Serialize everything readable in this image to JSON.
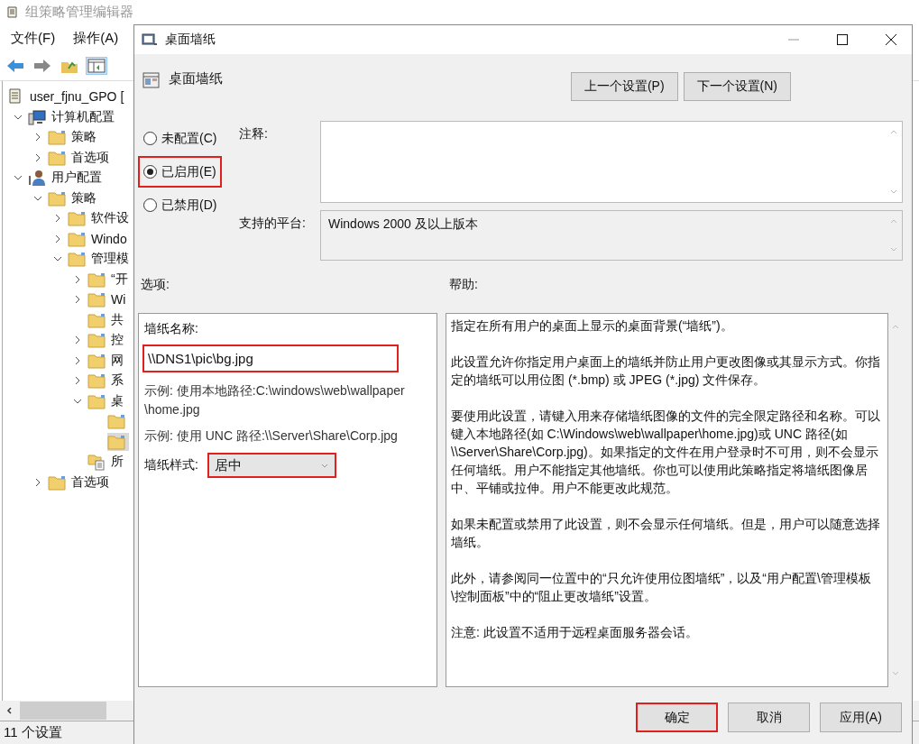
{
  "main_window": {
    "title": "组策略管理编辑器",
    "menu": [
      {
        "label": "文件(F)"
      },
      {
        "label": "操作(A)"
      }
    ],
    "tree": [
      {
        "label": "user_fjnu_GPO [",
        "kind": "root",
        "selected": false,
        "children": [
          {
            "label": "计算机配置",
            "kind": "computer",
            "expanded": true,
            "selected": false,
            "children": [
              {
                "label": "策略",
                "kind": "folder",
                "expanded": false,
                "selected": false
              },
              {
                "label": "首选项",
                "kind": "folder",
                "expanded": false,
                "selected": false
              }
            ]
          },
          {
            "label": "用户配置",
            "kind": "user",
            "expanded": true,
            "selected": false,
            "children": [
              {
                "label": "策略",
                "kind": "folder",
                "expanded": true,
                "selected": false,
                "children": [
                  {
                    "label": "软件设",
                    "kind": "folder",
                    "expanded": false,
                    "selected": false
                  },
                  {
                    "label": "Windo",
                    "kind": "folder",
                    "expanded": false,
                    "selected": false
                  },
                  {
                    "label": "管理模",
                    "kind": "folder",
                    "expanded": true,
                    "selected": false,
                    "children": [
                      {
                        "label": "“开",
                        "kind": "folder",
                        "expanded": false,
                        "selected": false
                      },
                      {
                        "label": "Wi",
                        "kind": "folder",
                        "expanded": false,
                        "selected": false
                      },
                      {
                        "label": "共",
                        "kind": "folder",
                        "selected": false
                      },
                      {
                        "label": "控",
                        "kind": "folder",
                        "expanded": false,
                        "selected": false
                      },
                      {
                        "label": "网",
                        "kind": "folder",
                        "expanded": false,
                        "selected": false
                      },
                      {
                        "label": "系",
                        "kind": "folder",
                        "expanded": false,
                        "selected": false
                      },
                      {
                        "label": "桌",
                        "kind": "folder",
                        "expanded": true,
                        "selected": false,
                        "children": [
                          {
                            "kind": "folder",
                            "selected": false
                          },
                          {
                            "kind": "folder",
                            "selected": true
                          }
                        ]
                      },
                      {
                        "label": "所",
                        "kind": "all-settings",
                        "selected": false
                      }
                    ]
                  }
                ]
              },
              {
                "label": "首选项",
                "kind": "folder",
                "expanded": false,
                "selected": false
              }
            ]
          }
        ]
      }
    ],
    "status": "11 个设置"
  },
  "dialog": {
    "title": "桌面墙纸",
    "setting_name": "桌面墙纸",
    "nav_buttons": [
      {
        "label": "上一个设置(P)"
      },
      {
        "label": "下一个设置(N)"
      }
    ],
    "radios": [
      {
        "label": "未配置(C)",
        "selected": false,
        "highlighted": false
      },
      {
        "label": "已启用(E)",
        "selected": true,
        "highlighted": true
      },
      {
        "label": "已禁用(D)",
        "selected": false,
        "highlighted": false
      }
    ],
    "comment_label": "注释:",
    "platform_label": "支持的平台:",
    "platform": "Windows 2000 及以上版本",
    "options_label": "选项:",
    "help_label": "帮助:",
    "options": {
      "name_label": "墙纸名称:",
      "name_value": "\\\\DNS1\\pic\\bg.jpg",
      "name_highlighted": true,
      "examples": [
        "示例: 使用本地路径:C:\\windows\\web\\wallpaper\\home.jpg",
        "示例: 使用 UNC 路径:\\\\Server\\Share\\Corp.jpg"
      ],
      "style_label": "墙纸样式:",
      "style_value": "居中",
      "style_highlighted": true
    },
    "help": [
      "指定在所有用户的桌面上显示的桌面背景(“墙纸”)。",
      "此设置允许你指定用户桌面上的墙纸并防止用户更改图像或其显示方式。你指定的墙纸可以用位图 (*.bmp) 或 JPEG (*.jpg) 文件保存。",
      "要使用此设置，请键入用来存储墙纸图像的文件的完全限定路径和名称。可以键入本地路径(如 C:\\Windows\\web\\wallpaper\\home.jpg)或 UNC 路径(如 \\\\Server\\Share\\Corp.jpg)。如果指定的文件在用户登录时不可用，则不会显示任何墙纸。用户不能指定其他墙纸。你也可以使用此策略指定将墙纸图像居中、平铺或拉伸。用户不能更改此规范。",
      "如果未配置或禁用了此设置，则不会显示任何墙纸。但是，用户可以随意选择墙纸。",
      "此外，请参阅同一位置中的“只允许使用位图墙纸”，以及“用户配置\\管理模板\\控制面板”中的“阻止更改墙纸”设置。",
      "注意: 此设置不适用于远程桌面服务器会话。"
    ],
    "buttons": [
      {
        "label": "确定",
        "highlighted": true
      },
      {
        "label": "取消",
        "highlighted": false
      },
      {
        "label": "应用(A)",
        "highlighted": false
      }
    ]
  }
}
